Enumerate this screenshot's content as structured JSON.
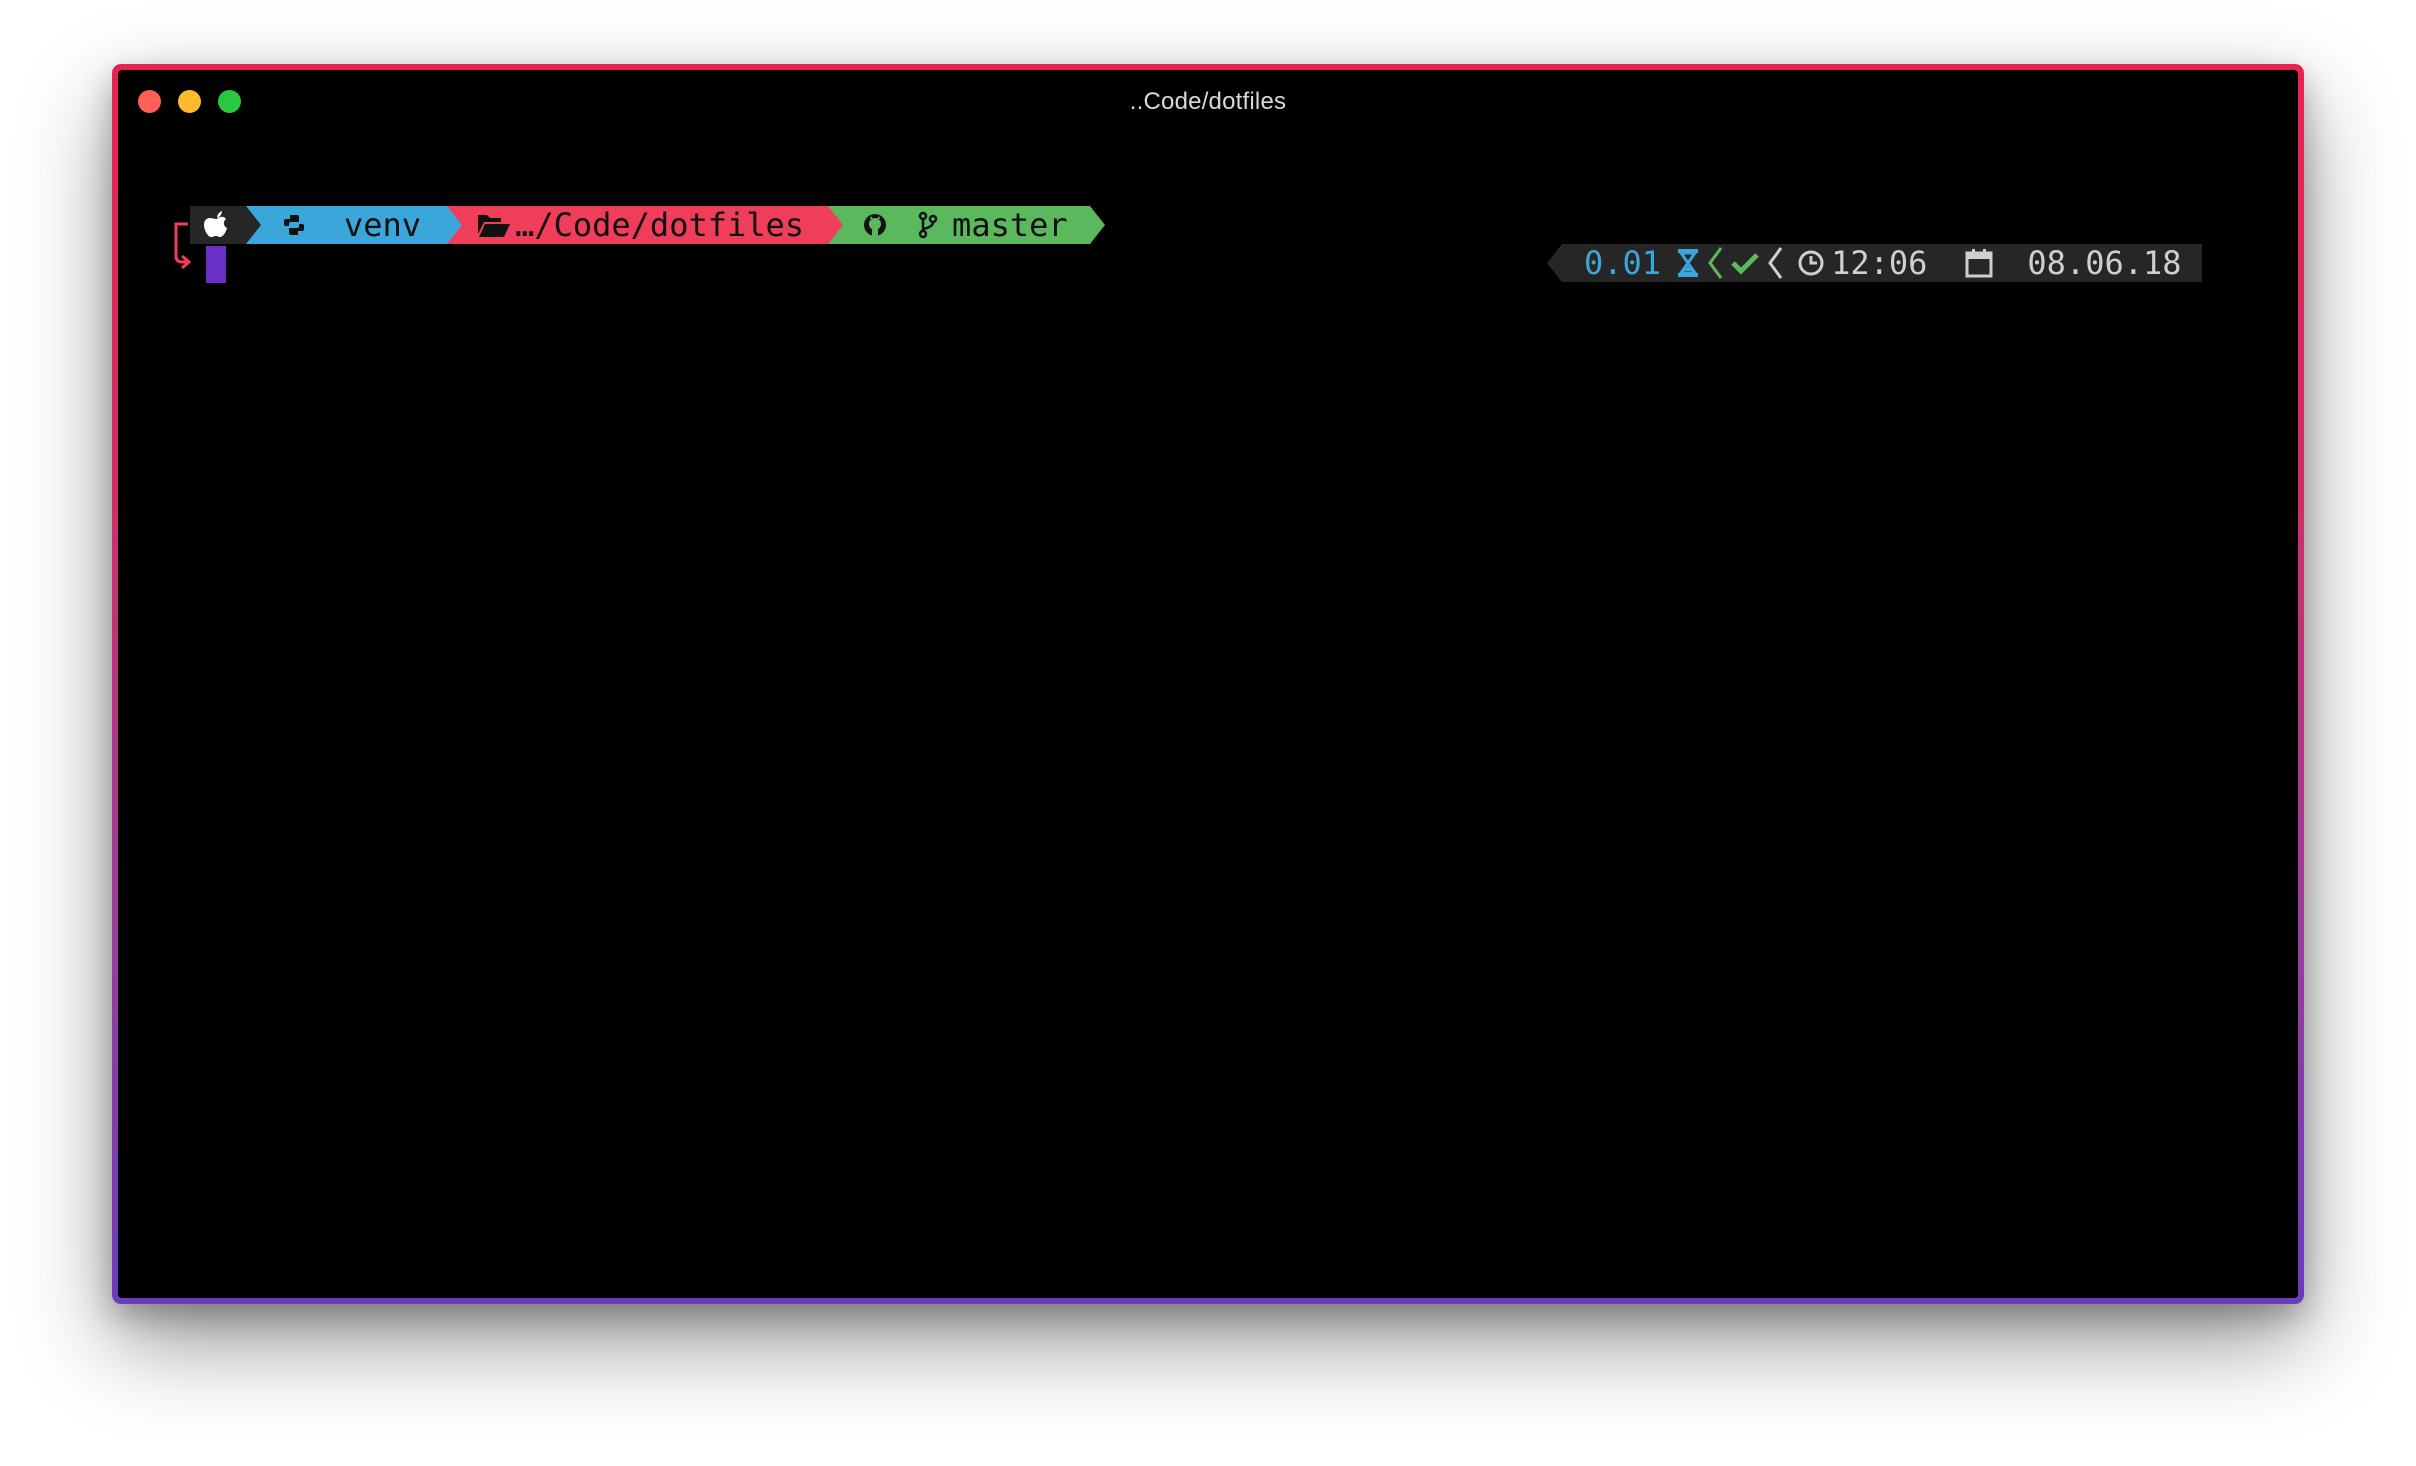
{
  "window": {
    "title": "..Code/dotfiles",
    "border_gradient": [
      "#e8234f",
      "#6a3bbd"
    ]
  },
  "prompt": {
    "os_icon": "apple-icon",
    "venv": {
      "icon": "python-icon",
      "label": "venv",
      "color": "#3aa6d9"
    },
    "dir": {
      "icon": "folder-open-icon",
      "label": "…/Code/dotfiles",
      "color": "#ef3d5a"
    },
    "git": {
      "icon": "github-icon",
      "branch_icon": "git-branch-icon",
      "label": "master",
      "color": "#5cb85c"
    },
    "cursor_color": "#6a2fc4"
  },
  "rprompt": {
    "exec_time": "0.01",
    "exec_icon": "hourglass-icon",
    "status_icon": "check-icon",
    "time_icon": "clock-icon",
    "time": "12:06",
    "date_icon": "calendar-icon",
    "date": "08.06.18"
  }
}
